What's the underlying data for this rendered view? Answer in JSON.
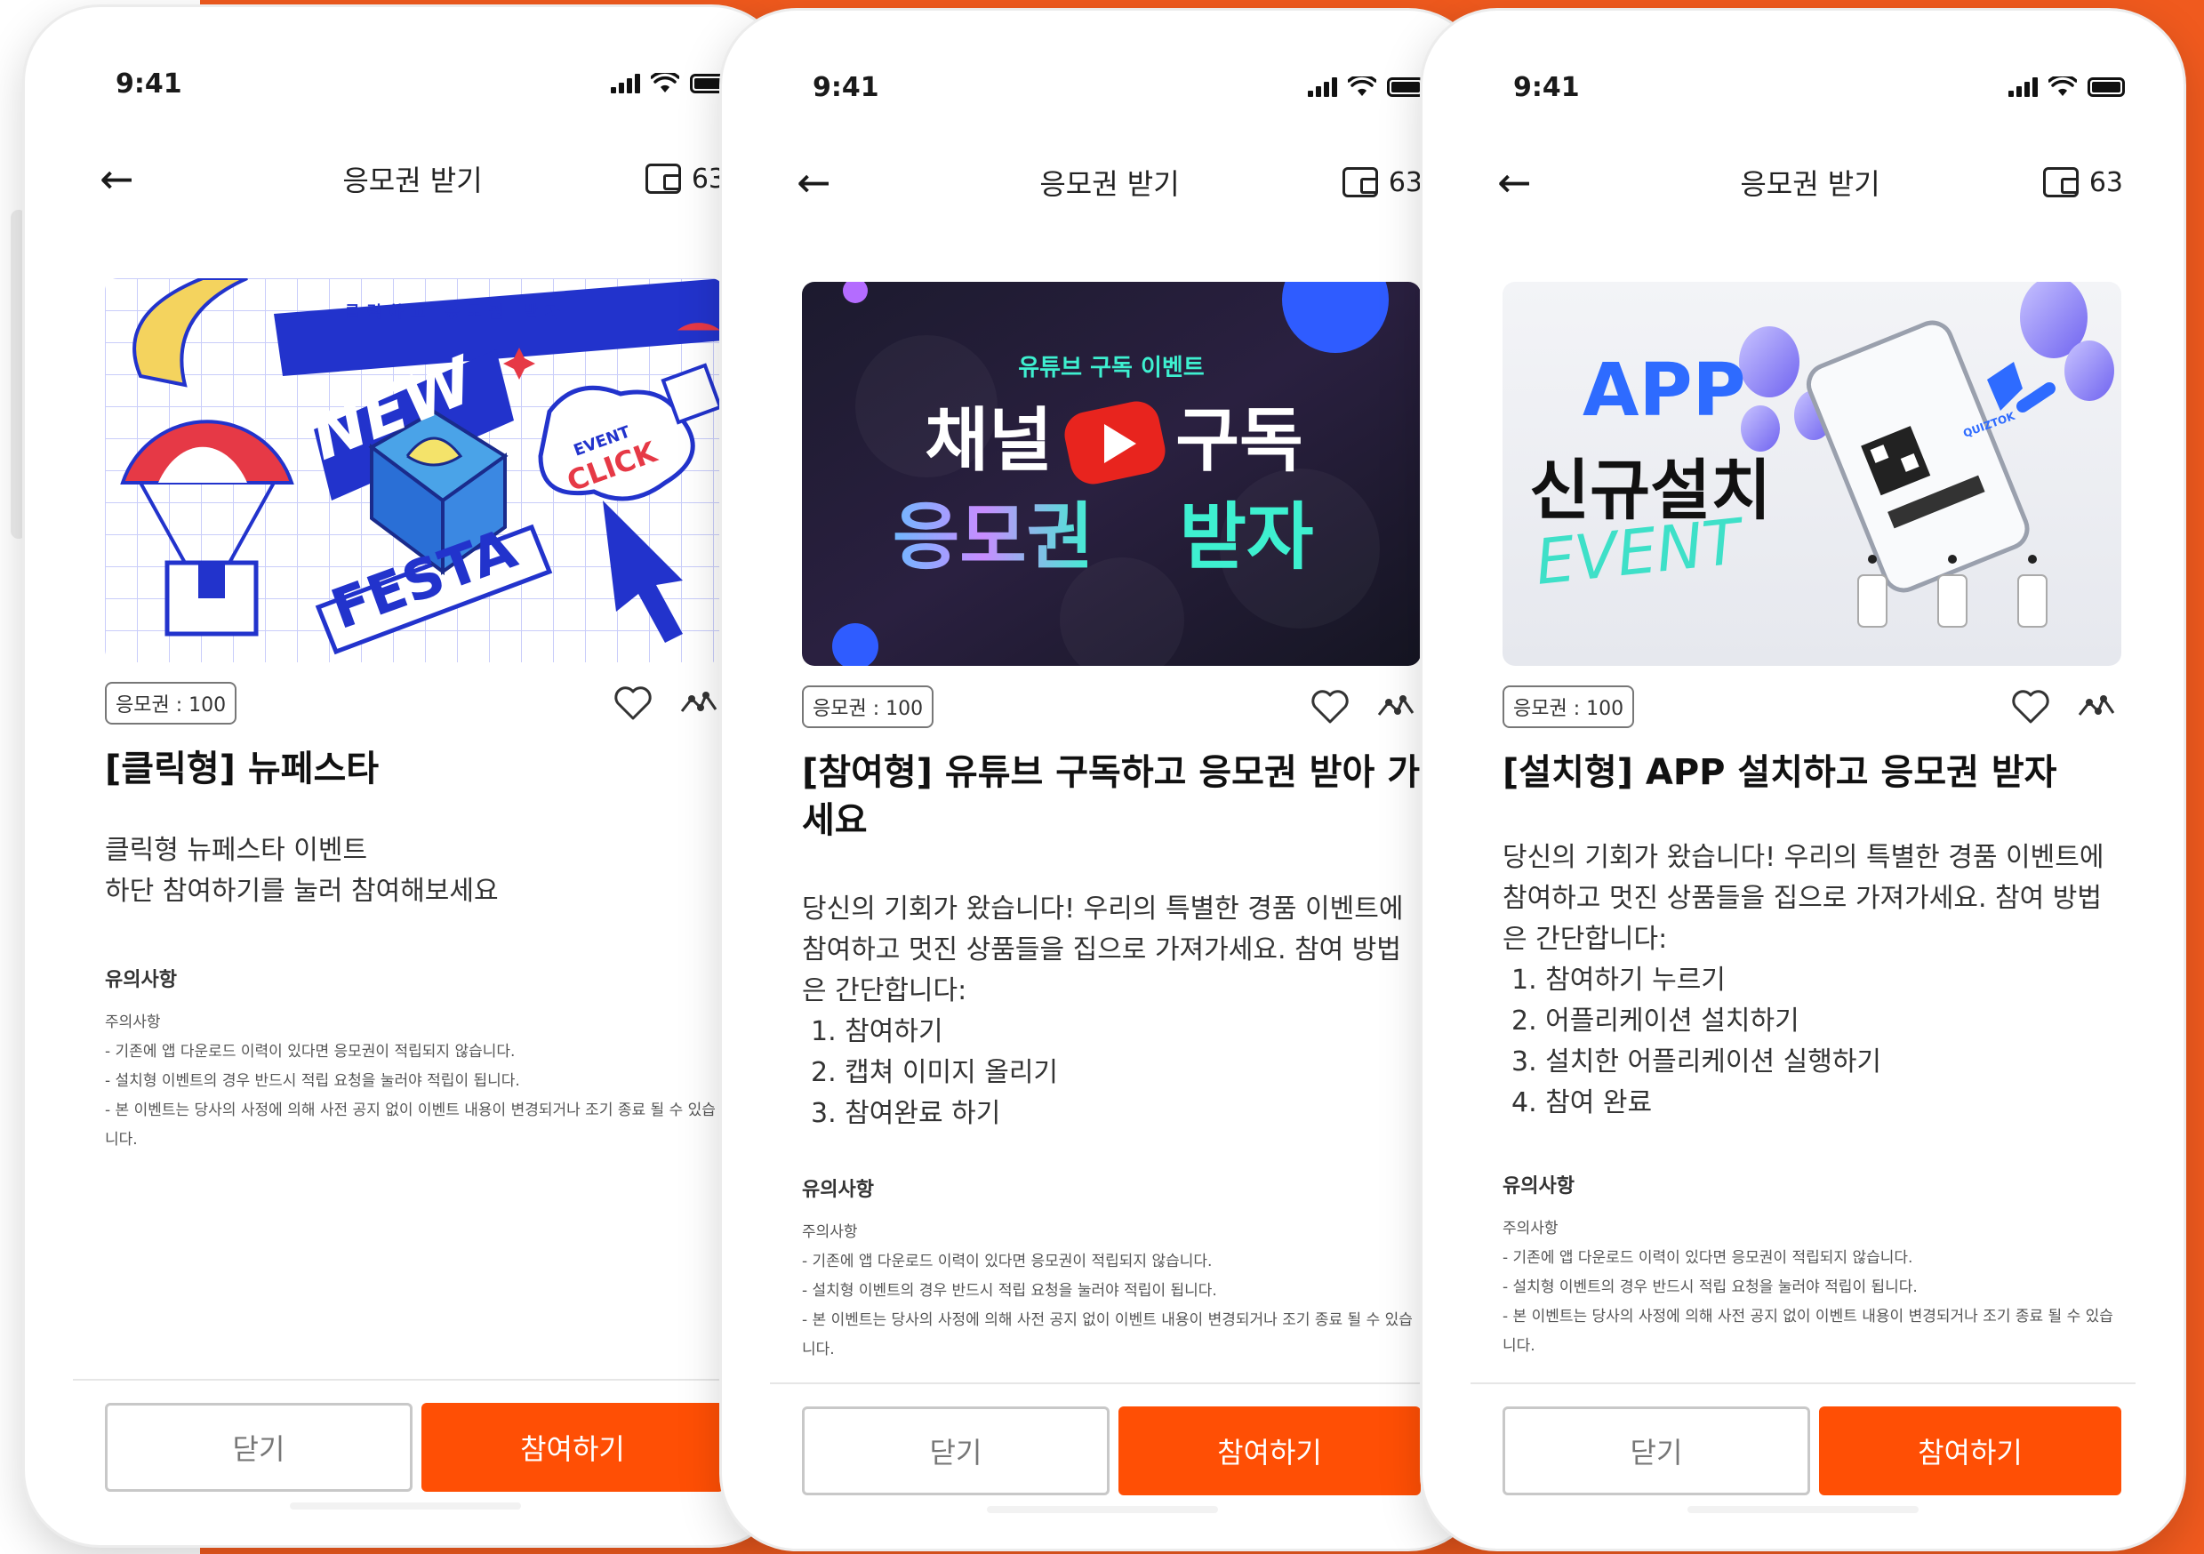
{
  "colors": {
    "accent": "#ff4f05",
    "background": "#f05a1e"
  },
  "phones": [
    {
      "time": "9:41",
      "header": {
        "title": "응모권 받기",
        "wallet_count": "63"
      },
      "banner": {
        "tagline": "클릭하고 응모권 받자",
        "word1": "NEW",
        "word2": "FESTA",
        "badge_top": "EVENT",
        "badge_bottom": "CLICK"
      },
      "badge": "응모권 : 100",
      "title": "[클릭형] 뉴페스타",
      "description": "클릭형 뉴페스타 이벤트\n하단 참여하기를 눌러 참여해보세요",
      "steps": [],
      "notice": {
        "heading": "유의사항",
        "sub": "주의사항",
        "lines": [
          "- 기존에 앱 다운로드 이력이 있다면 응모권이 적립되지 않습니다.",
          "- 설치형 이벤트의 경우 반드시 적립 요청을 눌러야 적립이 됩니다.",
          "- 본 이벤트는 당사의 사정에 의해 사전 공지 없이 이벤트 내용이 변경되거나 조기 종료 될 수 있습니다."
        ]
      },
      "buttons": {
        "close": "닫기",
        "join": "참여하기"
      }
    },
    {
      "time": "9:41",
      "header": {
        "title": "응모권 받기",
        "wallet_count": "63"
      },
      "banner": {
        "tagline": "유튜브 구독 이벤트",
        "line1_left": "채널",
        "line1_right": "구독",
        "line2_left": "응모권",
        "line2_right": "받자"
      },
      "badge": "응모권 : 100",
      "title": "[참여형] 유튜브 구독하고 응모권 받아 가세요",
      "description": "당신의 기회가 왔습니다! 우리의 특별한 경품 이벤트에 참여하고 멋진 상품들을 집으로 가져가세요. 참여 방법은 간단합니다:",
      "steps": [
        "1. 참여하기",
        "2. 캡쳐 이미지 올리기",
        "3. 참여완료 하기"
      ],
      "notice": {
        "heading": "유의사항",
        "sub": "주의사항",
        "lines": [
          "- 기존에 앱 다운로드 이력이 있다면 응모권이 적립되지 않습니다.",
          "- 설치형 이벤트의 경우 반드시 적립 요청을 눌러야 적립이 됩니다.",
          "- 본 이벤트는 당사의 사정에 의해 사전 공지 없이 이벤트 내용이 변경되거나 조기 종료 될 수 있습니다."
        ]
      },
      "buttons": {
        "close": "닫기",
        "join": "참여하기"
      }
    },
    {
      "time": "9:41",
      "header": {
        "title": "응모권 받기",
        "wallet_count": "63"
      },
      "banner": {
        "line1": "APP",
        "line2": "신규설치",
        "line3": "EVENT",
        "brand": "QUIZTOK"
      },
      "badge": "응모권 : 100",
      "title": "[설치형] APP 설치하고 응모권 받자",
      "description": "당신의 기회가 왔습니다! 우리의 특별한 경품 이벤트에 참여하고 멋진 상품들을 집으로 가져가세요. 참여 방법은 간단합니다:",
      "steps": [
        "1. 참여하기 누르기",
        "2. 어플리케이션 설치하기",
        "3. 설치한 어플리케이션 실행하기",
        "4. 참여 완료"
      ],
      "notice": {
        "heading": "유의사항",
        "sub": "주의사항",
        "lines": [
          "- 기존에 앱 다운로드 이력이 있다면 응모권이 적립되지 않습니다.",
          "- 설치형 이벤트의 경우 반드시 적립 요청을 눌러야 적립이 됩니다.",
          "- 본 이벤트는 당사의 사정에 의해 사전 공지 없이 이벤트 내용이 변경되거나 조기 종료 될 수 있습니다."
        ]
      },
      "buttons": {
        "close": "닫기",
        "join": "참여하기"
      }
    }
  ]
}
